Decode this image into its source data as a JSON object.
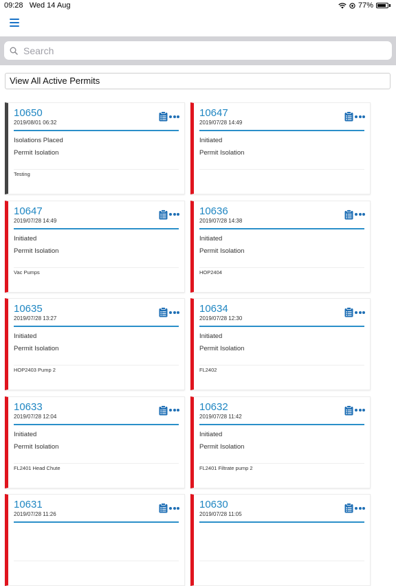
{
  "status_bar": {
    "time": "09:28",
    "date": "Wed 14 Aug",
    "battery": "77%"
  },
  "search": {
    "placeholder": "Search",
    "value": ""
  },
  "view_all_label": "View All Active Permits",
  "colors": {
    "accent": "#1f86c2",
    "status_red": "#e0141e",
    "status_gray": "#444444"
  },
  "permits": [
    {
      "id": "10650",
      "date": "2019/08/01 06:32",
      "status": "Isolations Placed",
      "type": "Permit Isolation",
      "description": "Testing",
      "bar": "gray"
    },
    {
      "id": "10647",
      "date": "2019/07/28 14:49",
      "status": "Initiated",
      "type": "Permit Isolation",
      "description": "",
      "bar": "red"
    },
    {
      "id": "10647",
      "date": "2019/07/28 14:49",
      "status": "Initiated",
      "type": "Permit Isolation",
      "description": "Vac Pumps",
      "bar": "red"
    },
    {
      "id": "10636",
      "date": "2019/07/28 14:38",
      "status": "Initiated",
      "type": "Permit Isolation",
      "description": "HOP2404",
      "bar": "red"
    },
    {
      "id": "10635",
      "date": "2019/07/28 13:27",
      "status": "Initiated",
      "type": "Permit Isolation",
      "description": "HOP2403 Pump 2",
      "bar": "red"
    },
    {
      "id": "10634",
      "date": "2019/07/28 12:30",
      "status": "Initiated",
      "type": "Permit Isolation",
      "description": "FL2402",
      "bar": "red"
    },
    {
      "id": "10633",
      "date": "2019/07/28 12:04",
      "status": "Initiated",
      "type": "Permit Isolation",
      "description": "FL2401 Head Chute",
      "bar": "red"
    },
    {
      "id": "10632",
      "date": "2019/07/28 11:42",
      "status": "Initiated",
      "type": "Permit Isolation",
      "description": "FL2401 Filtrate pump 2",
      "bar": "red"
    },
    {
      "id": "10631",
      "date": "2019/07/28 11:26",
      "status": "",
      "type": "",
      "description": "",
      "bar": "red"
    },
    {
      "id": "10630",
      "date": "2019/07/28 11:05",
      "status": "",
      "type": "",
      "description": "",
      "bar": "red"
    }
  ]
}
